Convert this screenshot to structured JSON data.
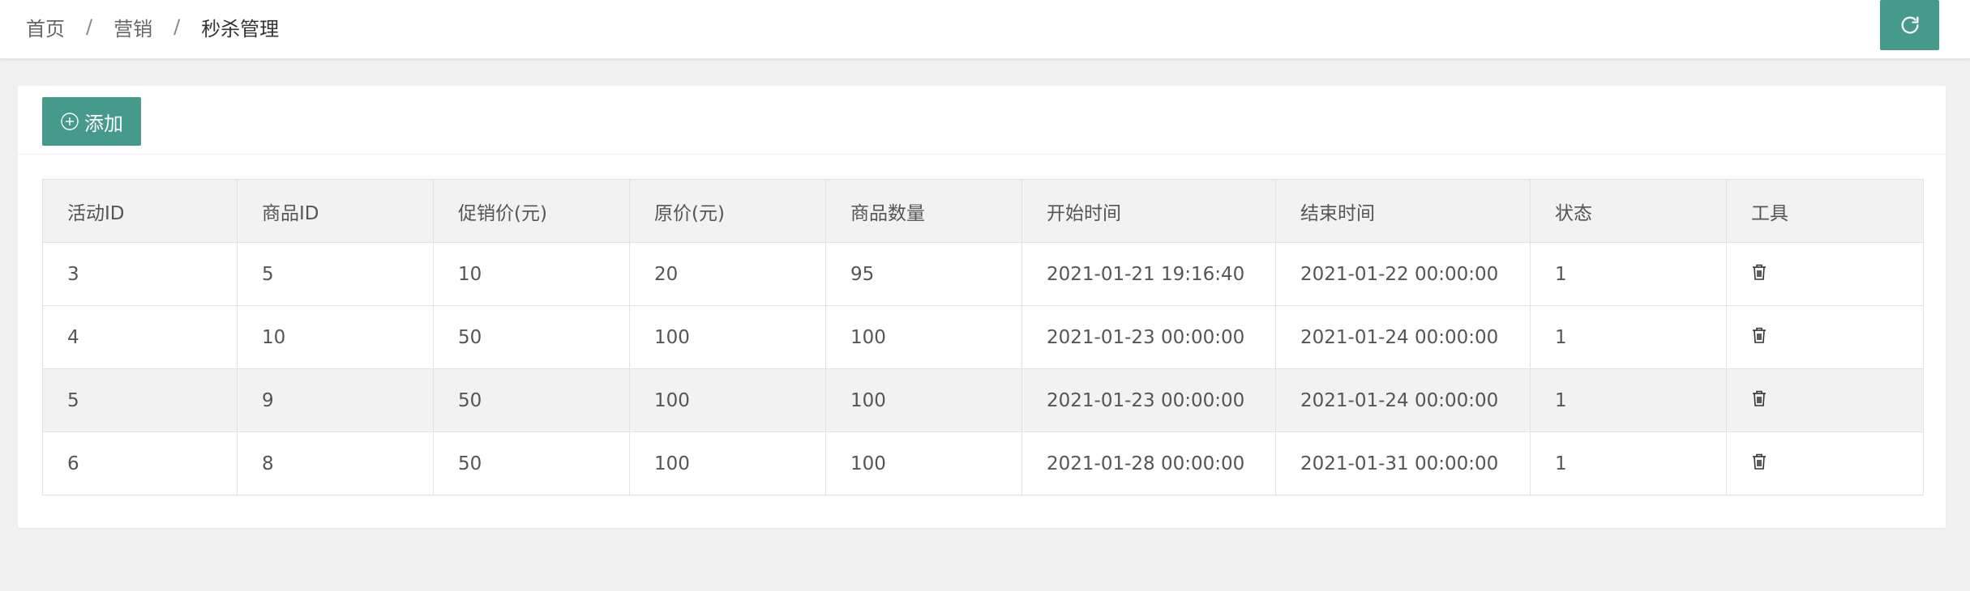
{
  "breadcrumb": {
    "items": [
      "首页",
      "营销",
      "秒杀管理"
    ],
    "separator": "/"
  },
  "toolbar": {
    "refresh_icon": "refresh-icon",
    "add_label": "添加",
    "add_icon": "plus-circle-icon"
  },
  "colors": {
    "accent": "#459a8c",
    "page_bg": "#f0f0f0",
    "header_bg": "#f2f2f2"
  },
  "table": {
    "columns": [
      "活动ID",
      "商品ID",
      "促销价(元)",
      "原价(元)",
      "商品数量",
      "开始时间",
      "结束时间",
      "状态",
      "工具"
    ],
    "rows": [
      [
        "3",
        "5",
        "10",
        "20",
        "95",
        "2021-01-21 19:16:40",
        "2021-01-22 00:00:00",
        "1"
      ],
      [
        "4",
        "10",
        "50",
        "100",
        "100",
        "2021-01-23 00:00:00",
        "2021-01-24 00:00:00",
        "1"
      ],
      [
        "5",
        "9",
        "50",
        "100",
        "100",
        "2021-01-23 00:00:00",
        "2021-01-24 00:00:00",
        "1"
      ],
      [
        "6",
        "8",
        "50",
        "100",
        "100",
        "2021-01-28 00:00:00",
        "2021-01-31 00:00:00",
        "1"
      ]
    ],
    "row_tool_icon": "trash-icon"
  }
}
